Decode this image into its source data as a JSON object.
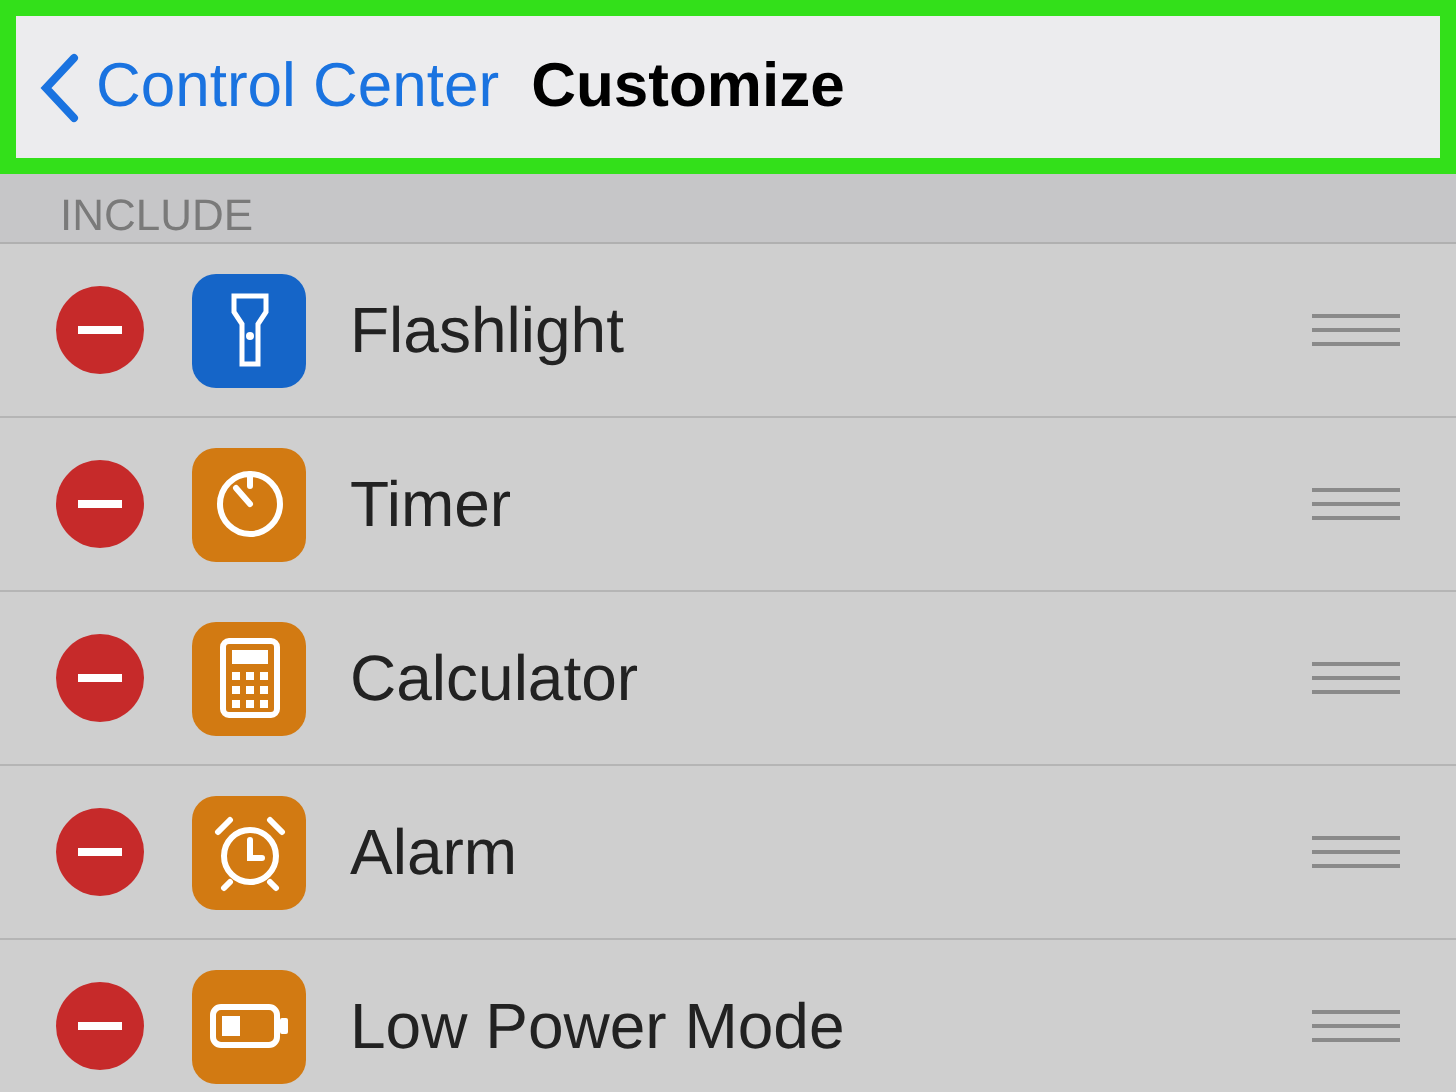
{
  "nav_bar": {
    "back_label": "Control Center",
    "title": "Customize",
    "highlighted": true
  },
  "section": {
    "header": "INCLUDE"
  },
  "items": [
    {
      "label": "Flashlight",
      "color": "#1565c8"
    },
    {
      "label": "Timer",
      "color": "#d27a12"
    },
    {
      "label": "Calculator",
      "color": "#d27a12"
    },
    {
      "label": "Alarm",
      "color": "#d27a12"
    },
    {
      "label": "Low Power Mode",
      "color": "#d27a12"
    }
  ]
}
